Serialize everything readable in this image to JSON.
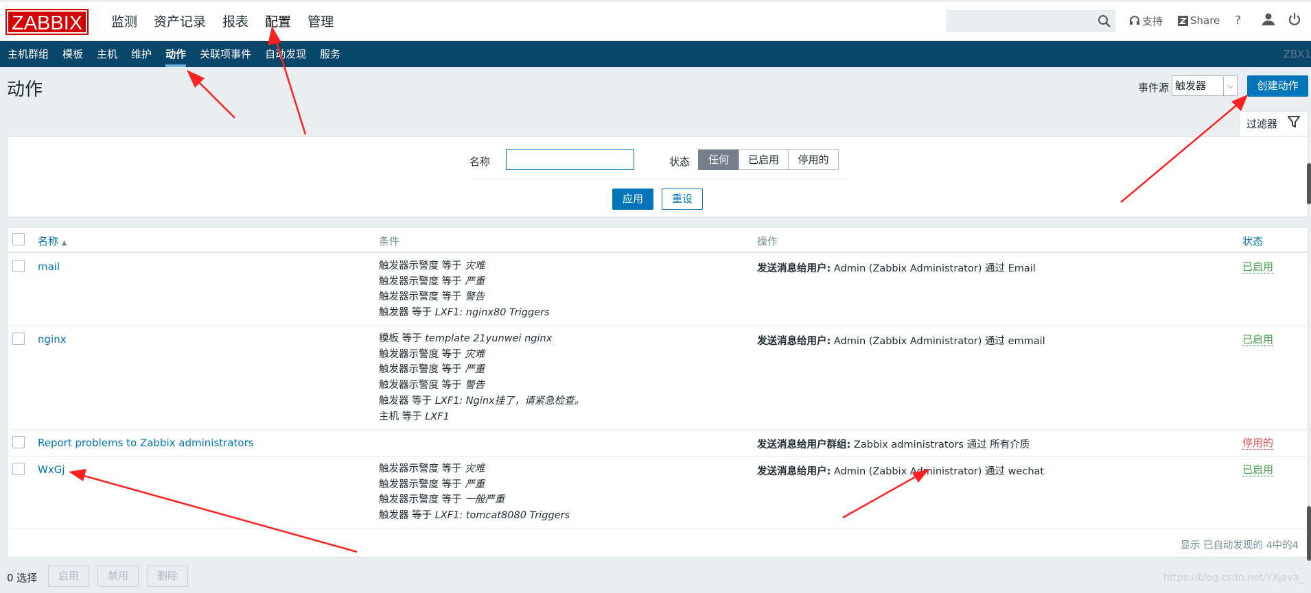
{
  "app": {
    "logo": "ZABBIX",
    "server": "ZBX1"
  },
  "main_menu": [
    {
      "label": "监测"
    },
    {
      "label": "资产记录"
    },
    {
      "label": "报表"
    },
    {
      "label": "配置"
    },
    {
      "label": "管理"
    }
  ],
  "top_right": {
    "support": "支持",
    "share": "Share",
    "help": "?"
  },
  "sub_menu": [
    {
      "label": "主机群组"
    },
    {
      "label": "模板"
    },
    {
      "label": "主机"
    },
    {
      "label": "维护"
    },
    {
      "label": "动作"
    },
    {
      "label": "关联项事件"
    },
    {
      "label": "自动发现"
    },
    {
      "label": "服务"
    }
  ],
  "header": {
    "title": "动作",
    "event_source_label": "事件源",
    "event_source_value": "触发器",
    "create_button": "创建动作"
  },
  "filter": {
    "tab_label": "过滤器",
    "name_label": "名称",
    "name_value": "",
    "status_label": "状态",
    "status_options": [
      "任何",
      "已启用",
      "停用的"
    ],
    "status_selected": "任何",
    "apply": "应用",
    "reset": "重设"
  },
  "table": {
    "columns": {
      "name": "名称",
      "sort_mark": "▲",
      "conditions": "条件",
      "operations": "操作",
      "status": "状态"
    },
    "rows": [
      {
        "name": "mail",
        "conditions": [
          {
            "pre": "触发器示警度 等于 ",
            "val": "灾难"
          },
          {
            "pre": "触发器示警度 等于 ",
            "val": "严重"
          },
          {
            "pre": "触发器示警度 等于 ",
            "val": "警告"
          },
          {
            "pre": "触发器 等于 ",
            "val": "LXF1: nginx80 Triggers"
          }
        ],
        "op_bold": "发送消息给用户:",
        "op_rest": " Admin (Zabbix Administrator) 通过 Email",
        "status": "已启用"
      },
      {
        "name": "nginx",
        "conditions": [
          {
            "pre": "模板 等于 ",
            "val": "template 21yunwei nginx"
          },
          {
            "pre": "触发器示警度 等于 ",
            "val": "灾难"
          },
          {
            "pre": "触发器示警度 等于 ",
            "val": "严重"
          },
          {
            "pre": "触发器示警度 等于 ",
            "val": "警告"
          },
          {
            "pre": "触发器 等于 ",
            "val": "LXF1: Nginx挂了，请紧急检查。"
          },
          {
            "pre": "主机 等于 ",
            "val": "LXF1"
          }
        ],
        "op_bold": "发送消息给用户:",
        "op_rest": " Admin (Zabbix Administrator) 通过 emmail",
        "status": "已启用"
      },
      {
        "name": "Report problems to Zabbix administrators",
        "conditions": [],
        "op_bold": "发送消息给用户群组:",
        "op_rest": " Zabbix administrators 通过 所有介质",
        "status": "停用的"
      },
      {
        "name": "WxGj",
        "conditions": [
          {
            "pre": "触发器示警度 等于 ",
            "val": "灾难"
          },
          {
            "pre": "触发器示警度 等于 ",
            "val": "严重"
          },
          {
            "pre": "触发器示警度 等于 ",
            "val": "一般严重"
          },
          {
            "pre": "触发器 等于 ",
            "val": "LXF1: tomcat8080 Triggers"
          }
        ],
        "op_bold": "发送消息给用户:",
        "op_rest": " Admin (Zabbix Administrator) 通过 wechat",
        "status": "已启用"
      }
    ],
    "footer": "显示 已自动发现的 4中的4"
  },
  "bottom_bar": {
    "selected": "0 选择",
    "enable": "启用",
    "disable": "禁用",
    "delete": "删除"
  },
  "watermark": "https://blog.csdn.net/YXjava_",
  "colors": {
    "logo_red": "#d40000",
    "subnav": "#0a466a",
    "primary": "#0275b8",
    "enabled": "#429e47",
    "disabled": "#d64e4e",
    "annotation_arrow": "#ff2020"
  }
}
